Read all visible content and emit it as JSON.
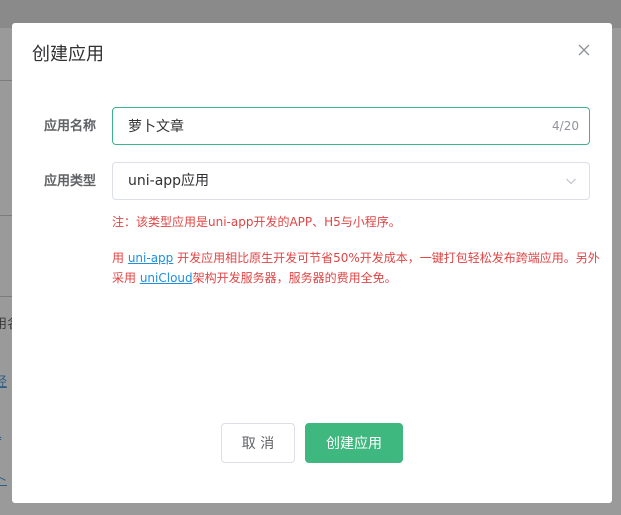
{
  "background": {
    "fragments": [
      {
        "text": "用名",
        "style": "dark"
      },
      {
        "text": "经",
        "style": "link"
      },
      {
        "text": "L",
        "style": "link"
      },
      {
        "text": "卜",
        "style": "link"
      }
    ]
  },
  "dialog": {
    "title": "创建应用",
    "close_icon": "close-icon",
    "form": {
      "name_label": "应用名称",
      "name_value": "萝卜文章",
      "name_count": "4/20",
      "type_label": "应用类型",
      "type_value": "uni-app应用",
      "type_icon": "chevron-down-icon"
    },
    "note": {
      "line1": "注：该类型应用是uni-app开发的APP、H5与小程序。",
      "p2_prefix": "用 ",
      "p2_link1": "uni-app",
      "p2_mid": " 开发应用相比原生开发可节省50%开发成本，一键打包轻松发布跨端应用。另外采用 ",
      "p2_link2": "uniCloud",
      "p2_suffix": "架构开发服务器，服务器的费用全免。"
    },
    "buttons": {
      "cancel_label": "取 消",
      "create_label": "创建应用"
    }
  },
  "colors": {
    "accent_green": "#3fb87f",
    "focus_border": "#3cb48a",
    "note_red": "#e04545",
    "link_blue": "#1f8fe0",
    "overlay": "#8a8a8a"
  }
}
